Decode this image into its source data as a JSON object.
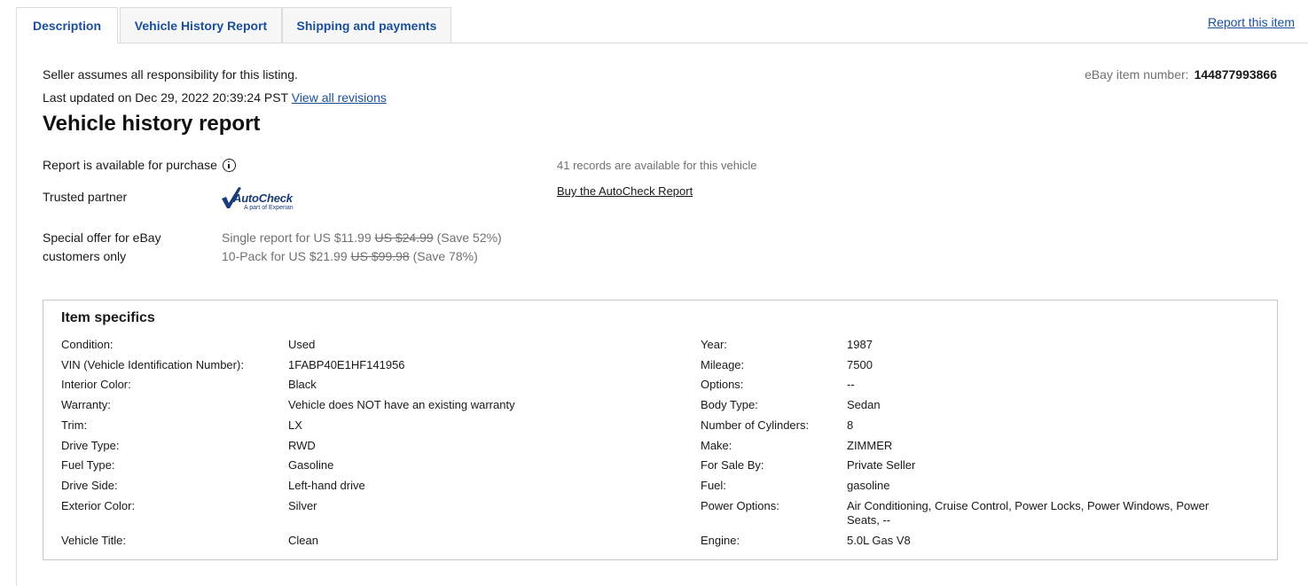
{
  "tabs": [
    {
      "label": "Description",
      "active": true
    },
    {
      "label": "Vehicle History Report",
      "active": false
    },
    {
      "label": "Shipping and payments",
      "active": false
    }
  ],
  "report_item_label": "Report this item",
  "seller_note": "Seller assumes all responsibility for this listing.",
  "last_updated_prefix": "Last updated on Dec 29, 2022 20:39:24 PST",
  "view_revisions_label": "View all revisions",
  "item_number_label": "eBay item number:",
  "item_number": "144877993866",
  "vehicle_history": {
    "title": "Vehicle history report",
    "available_label": "Report is available for purchase",
    "records_text": "41 records are available for this vehicle",
    "partner_label": "Trusted partner",
    "partner_brand": "AutoCheck",
    "partner_sub": "A part of Experian",
    "buy_label": "Buy the AutoCheck Report",
    "offer_label": "Special offer for eBay customers only",
    "offers": [
      {
        "text": "Single report for US $11.99",
        "was": "US $24.99",
        "save": "(Save 52%)"
      },
      {
        "text": "10-Pack for US $21.99",
        "was": "US $99.98",
        "save": "(Save 78%)"
      }
    ]
  },
  "item_specifics": {
    "title": "Item specifics",
    "left": [
      {
        "label": "Condition:",
        "value": "Used"
      },
      {
        "label": "VIN (Vehicle Identification Number):",
        "value": "1FABP40E1HF141956"
      },
      {
        "label": "Interior Color:",
        "value": "Black"
      },
      {
        "label": "Warranty:",
        "value": "Vehicle does NOT have an existing warranty"
      },
      {
        "label": "Trim:",
        "value": "LX"
      },
      {
        "label": "Drive Type:",
        "value": "RWD"
      },
      {
        "label": "Fuel Type:",
        "value": "Gasoline"
      },
      {
        "label": "Drive Side:",
        "value": "Left-hand drive"
      },
      {
        "label": "Exterior Color:",
        "value": "Silver"
      },
      {
        "label": "Vehicle Title:",
        "value": "Clean"
      }
    ],
    "right": [
      {
        "label": "Year:",
        "value": "1987"
      },
      {
        "label": "Mileage:",
        "value": "7500"
      },
      {
        "label": "Options:",
        "value": "--"
      },
      {
        "label": "Body Type:",
        "value": "Sedan"
      },
      {
        "label": "Number of Cylinders:",
        "value": "8"
      },
      {
        "label": "Make:",
        "value": "ZIMMER"
      },
      {
        "label": "For Sale By:",
        "value": "Private Seller"
      },
      {
        "label": "Fuel:",
        "value": "gasoline"
      },
      {
        "label": "Power Options:",
        "value": "Air Conditioning, Cruise Control, Power Locks, Power Windows, Power Seats, --"
      },
      {
        "label": "Engine:",
        "value": "5.0L Gas V8"
      }
    ]
  },
  "colors": {
    "link": "#1a4f9c",
    "text": "#191919",
    "muted": "#707070",
    "border": "#dcdcdc"
  }
}
